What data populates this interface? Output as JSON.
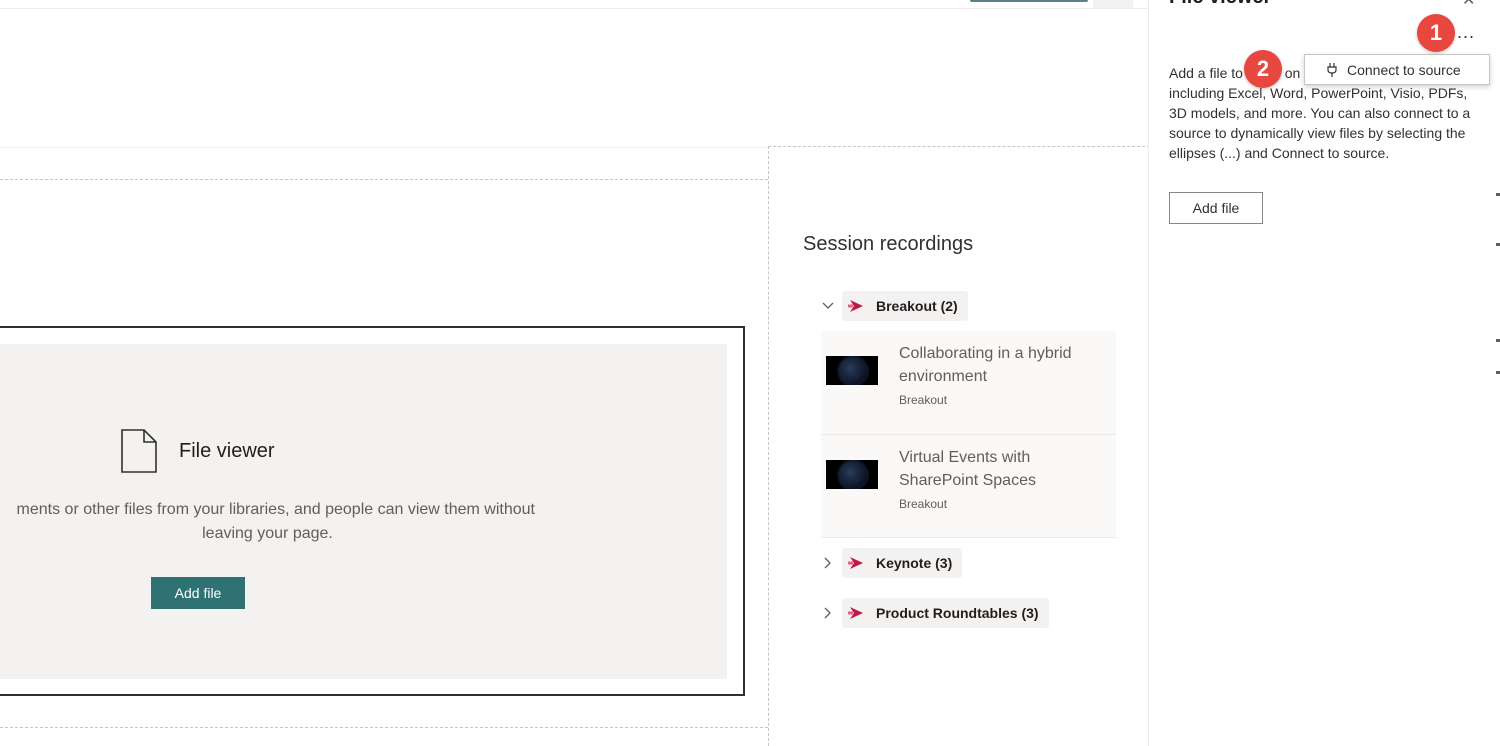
{
  "file_viewer_placeholder": {
    "title": "File viewer",
    "description_line1": "ments or other files from your libraries, and people can view them without",
    "description_line2": "leaving your page.",
    "add_file_label": "Add file"
  },
  "session_recordings": {
    "title": "Session recordings",
    "groups": [
      {
        "label": "Breakout (2)",
        "expanded": true
      },
      {
        "label": "Keynote (3)",
        "expanded": false
      },
      {
        "label": "Product Roundtables (3)",
        "expanded": false
      }
    ],
    "items": [
      {
        "title": "Collaborating in a hybrid environment",
        "category": "Breakout"
      },
      {
        "title": "Virtual Events with SharePoint Spaces",
        "category": "Breakout"
      }
    ]
  },
  "property_pane": {
    "title": "File viewer",
    "description_part1": "Add a file to",
    "description_part2": "on",
    "description_rest": "from a variety of file types including Excel, Word, PowerPoint, Visio, PDFs, 3D models, and more. You can also connect to a source to dynamically view files by selecting the ellipses (...) and Connect to source.",
    "add_file_label": "Add file",
    "more_options": "...",
    "menu": {
      "connect_to_source": "Connect to source"
    }
  },
  "callouts": {
    "marker1": "1",
    "marker2": "2"
  },
  "colors": {
    "accent": "#2f7274",
    "stream_brand": "#bc1948",
    "callout": "#e8473f"
  }
}
